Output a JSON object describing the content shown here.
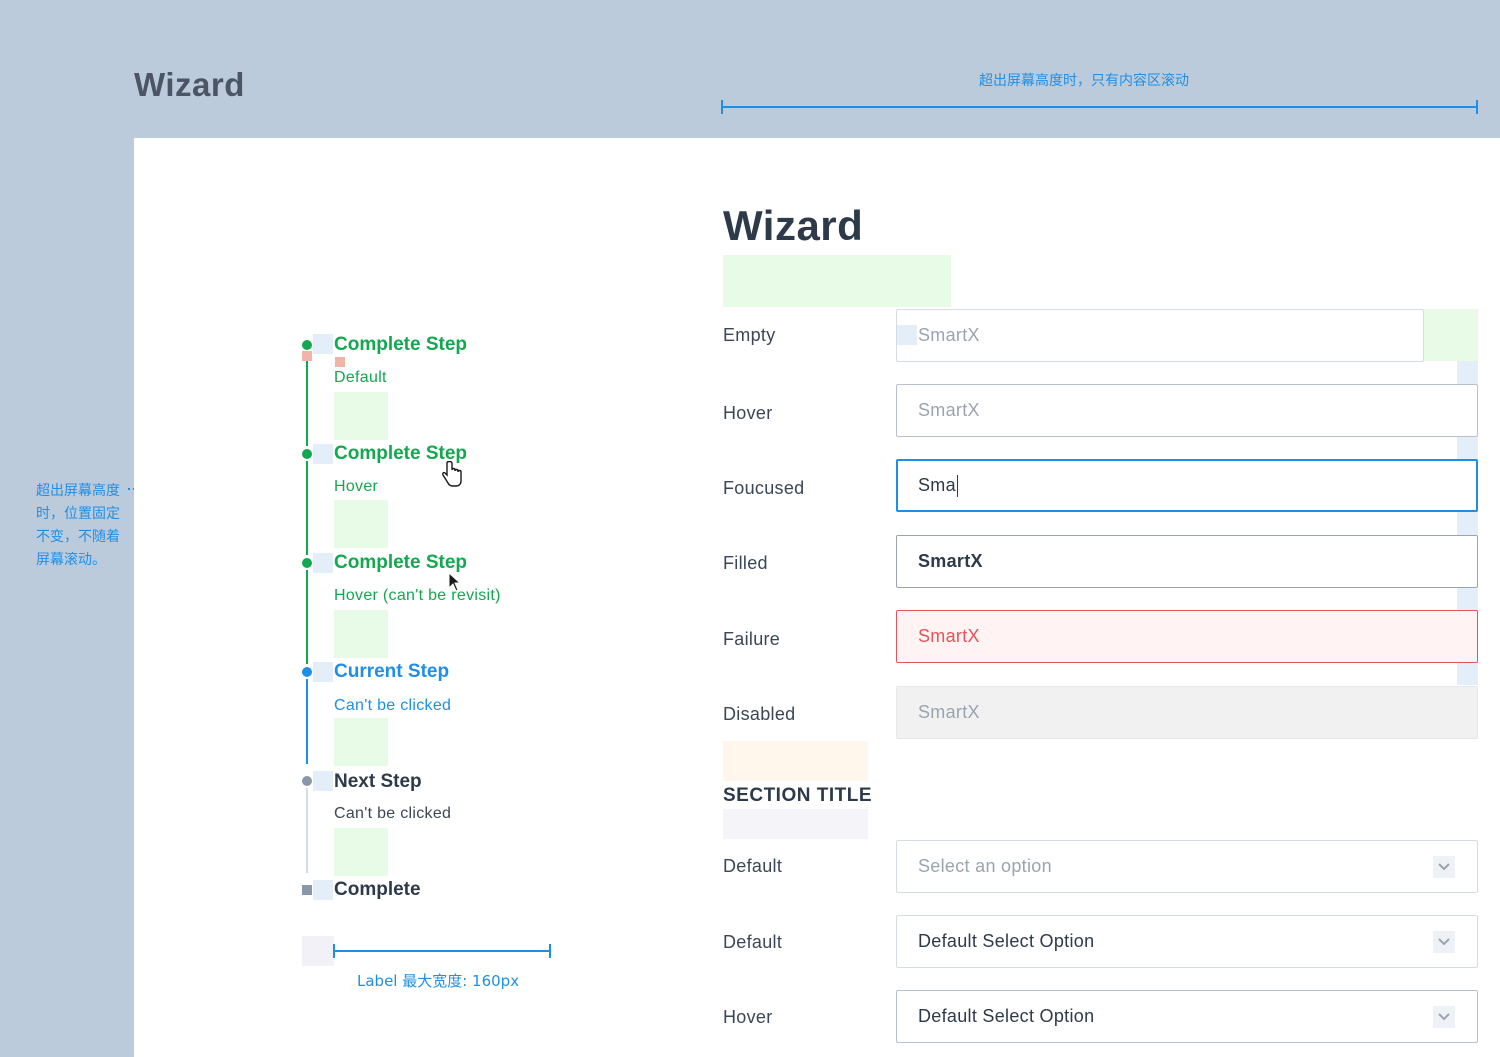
{
  "header": {
    "title": "Wizard",
    "scroll_note": "超出屏幕高度时，只有内容区滚动"
  },
  "side_note": {
    "text": "超出屏幕高度时，位置固定不变，不随着屏幕滚动。"
  },
  "steps": [
    {
      "title": "Complete Step",
      "sub": "Default",
      "state": "complete",
      "color": "#13a84f"
    },
    {
      "title": "Complete Step",
      "sub": "Hover",
      "state": "complete",
      "color": "#13a84f"
    },
    {
      "title": "Complete Step",
      "sub": "Hover (can't be revisit)",
      "state": "complete",
      "color": "#13a84f"
    },
    {
      "title": "Current Step",
      "sub": "Can't be clicked",
      "state": "current",
      "color": "#1f8fe6"
    },
    {
      "title": "Next Step",
      "sub": "Can't be clicked",
      "state": "next",
      "color": "#2d3a4a"
    },
    {
      "title": "Complete",
      "sub": "",
      "state": "final",
      "color": "#2d3a4a"
    }
  ],
  "label_width_note": "Label 最大宽度: 160px",
  "form": {
    "heading": "Wizard",
    "inputs": [
      {
        "label": "Empty",
        "value": "SmartX"
      },
      {
        "label": "Hover",
        "value": "SmartX"
      },
      {
        "label": "Foucused",
        "value": "Sma"
      },
      {
        "label": "Filled",
        "value": "SmartX"
      },
      {
        "label": "Failure",
        "value": "SmartX"
      },
      {
        "label": "Disabled",
        "value": "SmartX"
      }
    ],
    "section_title": "SECTION TITLE",
    "selects": [
      {
        "label": "Default",
        "value": "Select an option"
      },
      {
        "label": "Default",
        "value": "Default Select Option"
      },
      {
        "label": "Hover",
        "value": "Default Select Option"
      }
    ]
  },
  "colors": {
    "complete": "#13a84f",
    "current": "#1f8fe6",
    "next": "#8a97a8",
    "error": "#e8535a",
    "annotation": "#1f8fe6"
  }
}
